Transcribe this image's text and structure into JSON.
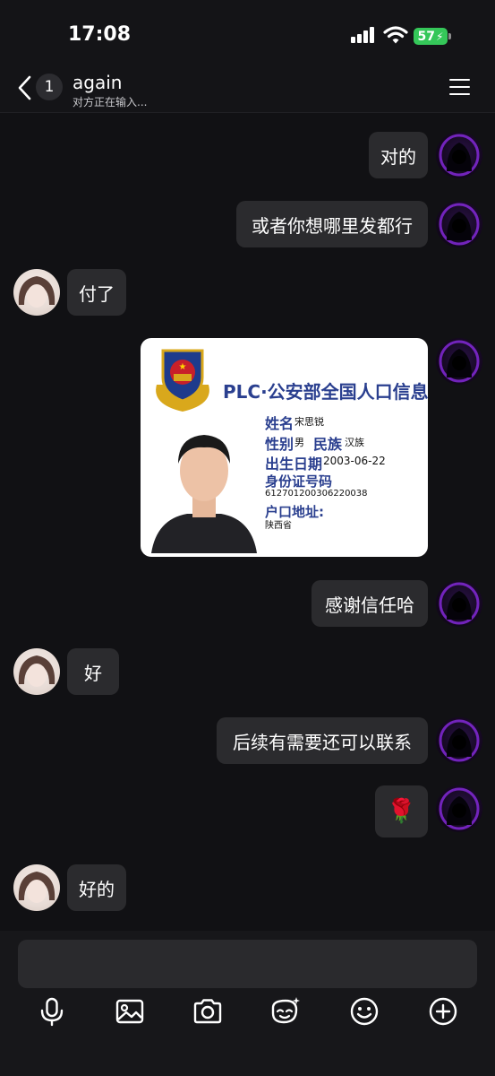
{
  "status_bar": {
    "time": "17:08",
    "battery": "57"
  },
  "header": {
    "unread_count": "1",
    "title": "again",
    "status": "对方正在输入..."
  },
  "messages": [
    {
      "sender": "me",
      "text": "对的"
    },
    {
      "sender": "me",
      "text": "或者你想哪里发都行"
    },
    {
      "sender": "them",
      "text": "付了"
    },
    {
      "sender": "me",
      "type": "image",
      "card": {
        "title": "PLC·公安部全国人口信息库",
        "name_label": "姓名",
        "name_value": "宋思锐",
        "gender_label": "性别",
        "gender_value": "男",
        "ethnicity_label": "民族",
        "ethnicity_value": "汉族",
        "dob_label": "出生日期",
        "dob_value": "2003-06-22",
        "id_label": "身份证号码",
        "id_value": "612701200306220038",
        "address_label": "户口地址:",
        "address_value": "陕西省"
      }
    },
    {
      "sender": "me",
      "text": "感谢信任哈"
    },
    {
      "sender": "them",
      "text": "好"
    },
    {
      "sender": "me",
      "text": "后续有需要还可以联系"
    },
    {
      "sender": "me",
      "type": "emoji",
      "text": "🌹"
    },
    {
      "sender": "them",
      "text": "好的"
    }
  ],
  "toolbar": [
    "microphone-icon",
    "image-icon",
    "camera-icon",
    "sticker-icon",
    "emoji-icon",
    "plus-icon"
  ],
  "colors": {
    "background": "#111114",
    "bubble": "#2b2b2e",
    "card_title": "#2a3f8f",
    "battery": "#35c759"
  }
}
